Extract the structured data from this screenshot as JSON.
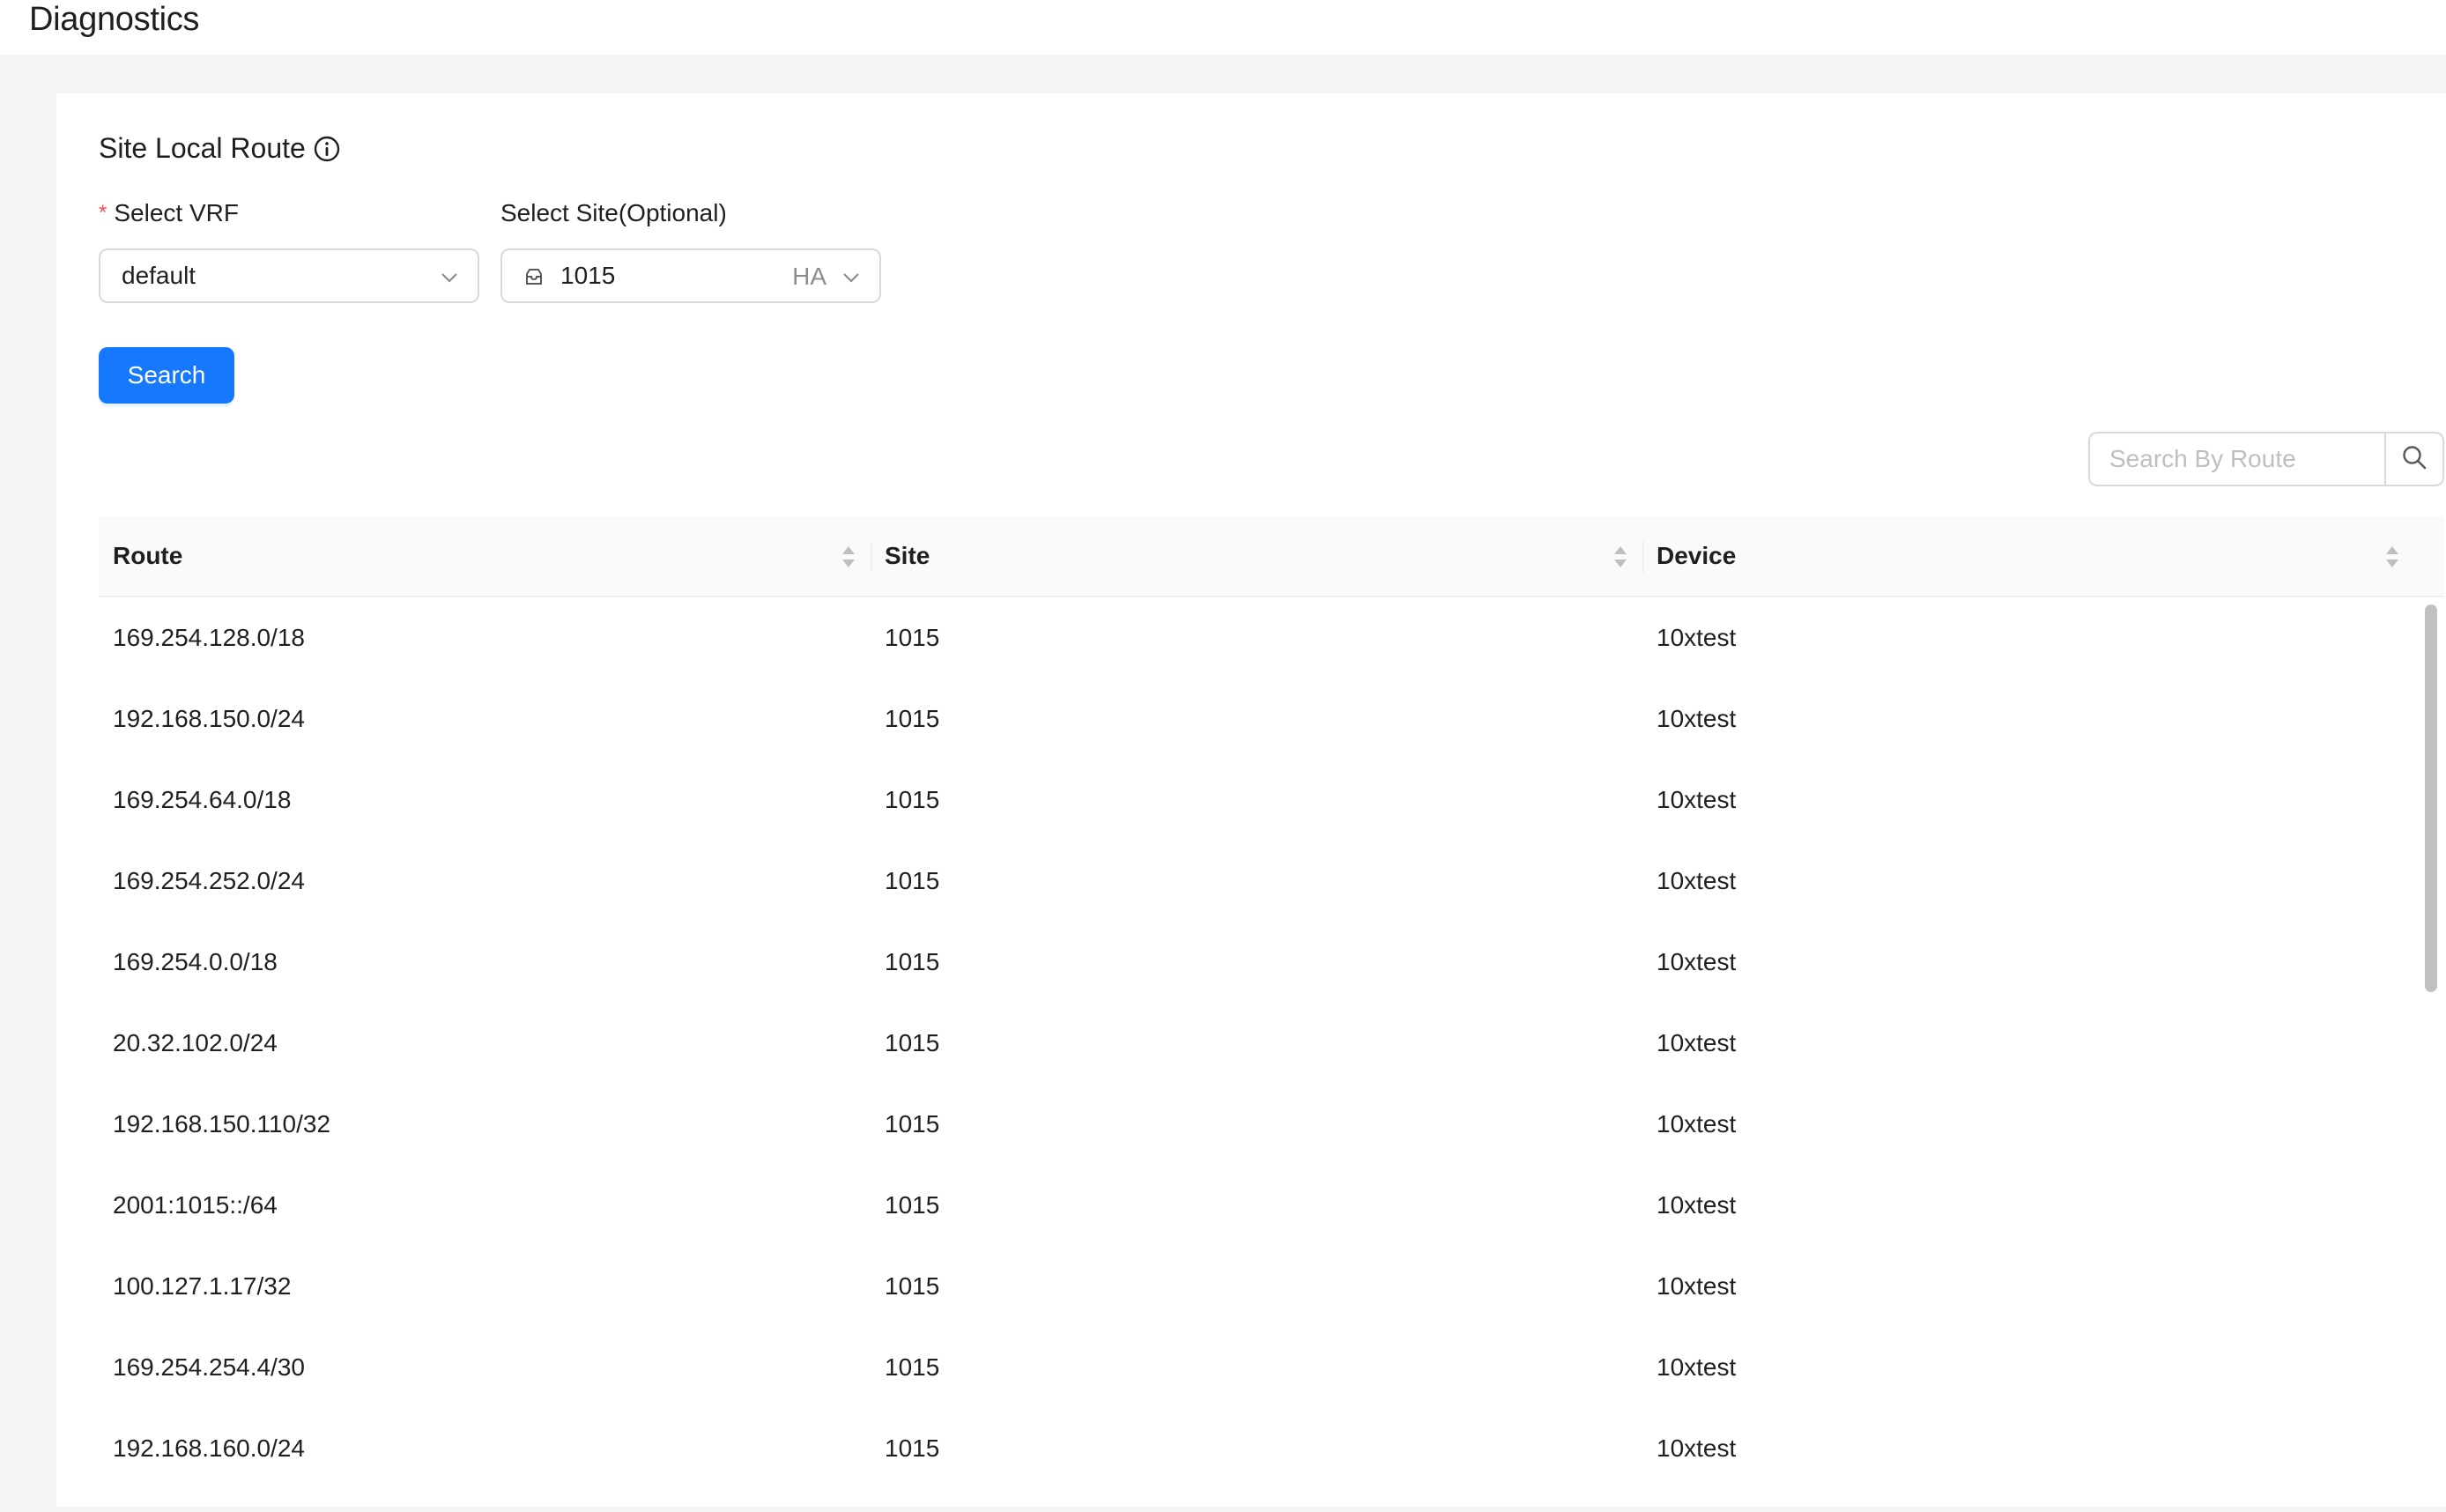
{
  "header": {
    "title": "Diagnostics"
  },
  "section": {
    "title": "Site Local Route",
    "info_icon": "info-circle-icon"
  },
  "filters": {
    "vrf": {
      "label": "Select VRF",
      "required_mark": "*",
      "value": "default",
      "icon": "chevron-down-icon"
    },
    "site": {
      "label": "Select Site(Optional)",
      "value": "1015",
      "tag": "HA",
      "icon": "site-icon"
    },
    "search_button": "Search"
  },
  "route_search": {
    "placeholder": "Search By Route",
    "icon": "search-icon"
  },
  "table": {
    "columns": [
      "Route",
      "Site",
      "Device"
    ],
    "rows": [
      [
        "169.254.128.0/18",
        "1015",
        "10xtest"
      ],
      [
        "192.168.150.0/24",
        "1015",
        "10xtest"
      ],
      [
        "169.254.64.0/18",
        "1015",
        "10xtest"
      ],
      [
        "169.254.252.0/24",
        "1015",
        "10xtest"
      ],
      [
        "169.254.0.0/18",
        "1015",
        "10xtest"
      ],
      [
        "20.32.102.0/24",
        "1015",
        "10xtest"
      ],
      [
        "192.168.150.110/32",
        "1015",
        "10xtest"
      ],
      [
        "2001:1015::/64",
        "1015",
        "10xtest"
      ],
      [
        "100.127.1.17/32",
        "1015",
        "10xtest"
      ],
      [
        "169.254.254.4/30",
        "1015",
        "10xtest"
      ],
      [
        "192.168.160.0/24",
        "1015",
        "10xtest"
      ]
    ]
  },
  "colors": {
    "primary": "#1677ff",
    "required": "#ff4d4f",
    "background": "#f5f5f5",
    "header_bg": "#fafafa"
  }
}
